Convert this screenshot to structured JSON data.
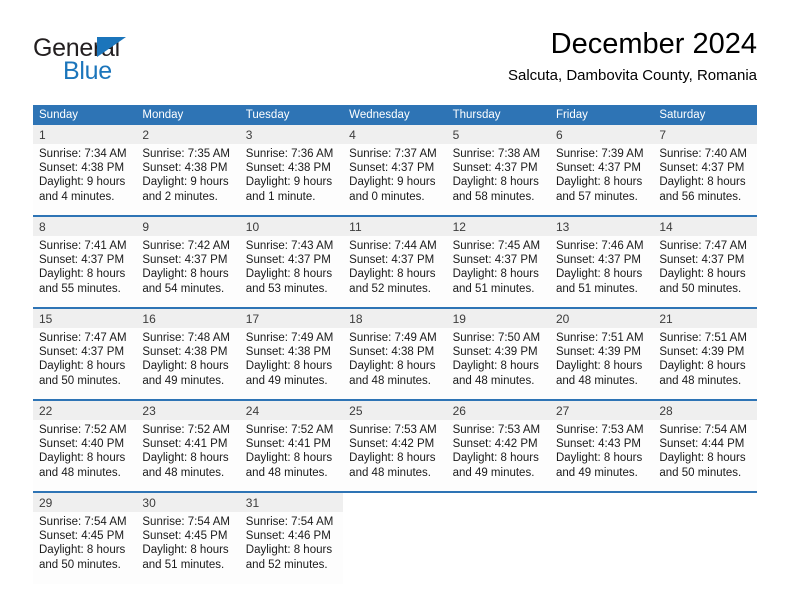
{
  "brand": {
    "name_part1": "General",
    "name_part2": "Blue",
    "triangle_icon": "triangle-icon",
    "primary_color": "#1b75bb"
  },
  "header": {
    "title": "December 2024",
    "subtitle": "Salcuta, Dambovita County, Romania"
  },
  "theme": {
    "header_bg": "#2e74b5",
    "daynum_bg": "#efefef",
    "cell_bg": "#fdfdfd"
  },
  "weekdays": [
    "Sunday",
    "Monday",
    "Tuesday",
    "Wednesday",
    "Thursday",
    "Friday",
    "Saturday"
  ],
  "weeks": [
    {
      "days": [
        {
          "num": "1",
          "sunrise": "Sunrise: 7:34 AM",
          "sunset": "Sunset: 4:38 PM",
          "daylight_1": "Daylight: 9 hours",
          "daylight_2": "and 4 minutes."
        },
        {
          "num": "2",
          "sunrise": "Sunrise: 7:35 AM",
          "sunset": "Sunset: 4:38 PM",
          "daylight_1": "Daylight: 9 hours",
          "daylight_2": "and 2 minutes."
        },
        {
          "num": "3",
          "sunrise": "Sunrise: 7:36 AM",
          "sunset": "Sunset: 4:38 PM",
          "daylight_1": "Daylight: 9 hours",
          "daylight_2": "and 1 minute."
        },
        {
          "num": "4",
          "sunrise": "Sunrise: 7:37 AM",
          "sunset": "Sunset: 4:37 PM",
          "daylight_1": "Daylight: 9 hours",
          "daylight_2": "and 0 minutes."
        },
        {
          "num": "5",
          "sunrise": "Sunrise: 7:38 AM",
          "sunset": "Sunset: 4:37 PM",
          "daylight_1": "Daylight: 8 hours",
          "daylight_2": "and 58 minutes."
        },
        {
          "num": "6",
          "sunrise": "Sunrise: 7:39 AM",
          "sunset": "Sunset: 4:37 PM",
          "daylight_1": "Daylight: 8 hours",
          "daylight_2": "and 57 minutes."
        },
        {
          "num": "7",
          "sunrise": "Sunrise: 7:40 AM",
          "sunset": "Sunset: 4:37 PM",
          "daylight_1": "Daylight: 8 hours",
          "daylight_2": "and 56 minutes."
        }
      ]
    },
    {
      "days": [
        {
          "num": "8",
          "sunrise": "Sunrise: 7:41 AM",
          "sunset": "Sunset: 4:37 PM",
          "daylight_1": "Daylight: 8 hours",
          "daylight_2": "and 55 minutes."
        },
        {
          "num": "9",
          "sunrise": "Sunrise: 7:42 AM",
          "sunset": "Sunset: 4:37 PM",
          "daylight_1": "Daylight: 8 hours",
          "daylight_2": "and 54 minutes."
        },
        {
          "num": "10",
          "sunrise": "Sunrise: 7:43 AM",
          "sunset": "Sunset: 4:37 PM",
          "daylight_1": "Daylight: 8 hours",
          "daylight_2": "and 53 minutes."
        },
        {
          "num": "11",
          "sunrise": "Sunrise: 7:44 AM",
          "sunset": "Sunset: 4:37 PM",
          "daylight_1": "Daylight: 8 hours",
          "daylight_2": "and 52 minutes."
        },
        {
          "num": "12",
          "sunrise": "Sunrise: 7:45 AM",
          "sunset": "Sunset: 4:37 PM",
          "daylight_1": "Daylight: 8 hours",
          "daylight_2": "and 51 minutes."
        },
        {
          "num": "13",
          "sunrise": "Sunrise: 7:46 AM",
          "sunset": "Sunset: 4:37 PM",
          "daylight_1": "Daylight: 8 hours",
          "daylight_2": "and 51 minutes."
        },
        {
          "num": "14",
          "sunrise": "Sunrise: 7:47 AM",
          "sunset": "Sunset: 4:37 PM",
          "daylight_1": "Daylight: 8 hours",
          "daylight_2": "and 50 minutes."
        }
      ]
    },
    {
      "days": [
        {
          "num": "15",
          "sunrise": "Sunrise: 7:47 AM",
          "sunset": "Sunset: 4:37 PM",
          "daylight_1": "Daylight: 8 hours",
          "daylight_2": "and 50 minutes."
        },
        {
          "num": "16",
          "sunrise": "Sunrise: 7:48 AM",
          "sunset": "Sunset: 4:38 PM",
          "daylight_1": "Daylight: 8 hours",
          "daylight_2": "and 49 minutes."
        },
        {
          "num": "17",
          "sunrise": "Sunrise: 7:49 AM",
          "sunset": "Sunset: 4:38 PM",
          "daylight_1": "Daylight: 8 hours",
          "daylight_2": "and 49 minutes."
        },
        {
          "num": "18",
          "sunrise": "Sunrise: 7:49 AM",
          "sunset": "Sunset: 4:38 PM",
          "daylight_1": "Daylight: 8 hours",
          "daylight_2": "and 48 minutes."
        },
        {
          "num": "19",
          "sunrise": "Sunrise: 7:50 AM",
          "sunset": "Sunset: 4:39 PM",
          "daylight_1": "Daylight: 8 hours",
          "daylight_2": "and 48 minutes."
        },
        {
          "num": "20",
          "sunrise": "Sunrise: 7:51 AM",
          "sunset": "Sunset: 4:39 PM",
          "daylight_1": "Daylight: 8 hours",
          "daylight_2": "and 48 minutes."
        },
        {
          "num": "21",
          "sunrise": "Sunrise: 7:51 AM",
          "sunset": "Sunset: 4:39 PM",
          "daylight_1": "Daylight: 8 hours",
          "daylight_2": "and 48 minutes."
        }
      ]
    },
    {
      "days": [
        {
          "num": "22",
          "sunrise": "Sunrise: 7:52 AM",
          "sunset": "Sunset: 4:40 PM",
          "daylight_1": "Daylight: 8 hours",
          "daylight_2": "and 48 minutes."
        },
        {
          "num": "23",
          "sunrise": "Sunrise: 7:52 AM",
          "sunset": "Sunset: 4:41 PM",
          "daylight_1": "Daylight: 8 hours",
          "daylight_2": "and 48 minutes."
        },
        {
          "num": "24",
          "sunrise": "Sunrise: 7:52 AM",
          "sunset": "Sunset: 4:41 PM",
          "daylight_1": "Daylight: 8 hours",
          "daylight_2": "and 48 minutes."
        },
        {
          "num": "25",
          "sunrise": "Sunrise: 7:53 AM",
          "sunset": "Sunset: 4:42 PM",
          "daylight_1": "Daylight: 8 hours",
          "daylight_2": "and 48 minutes."
        },
        {
          "num": "26",
          "sunrise": "Sunrise: 7:53 AM",
          "sunset": "Sunset: 4:42 PM",
          "daylight_1": "Daylight: 8 hours",
          "daylight_2": "and 49 minutes."
        },
        {
          "num": "27",
          "sunrise": "Sunrise: 7:53 AM",
          "sunset": "Sunset: 4:43 PM",
          "daylight_1": "Daylight: 8 hours",
          "daylight_2": "and 49 minutes."
        },
        {
          "num": "28",
          "sunrise": "Sunrise: 7:54 AM",
          "sunset": "Sunset: 4:44 PM",
          "daylight_1": "Daylight: 8 hours",
          "daylight_2": "and 50 minutes."
        }
      ]
    },
    {
      "days": [
        {
          "num": "29",
          "sunrise": "Sunrise: 7:54 AM",
          "sunset": "Sunset: 4:45 PM",
          "daylight_1": "Daylight: 8 hours",
          "daylight_2": "and 50 minutes."
        },
        {
          "num": "30",
          "sunrise": "Sunrise: 7:54 AM",
          "sunset": "Sunset: 4:45 PM",
          "daylight_1": "Daylight: 8 hours",
          "daylight_2": "and 51 minutes."
        },
        {
          "num": "31",
          "sunrise": "Sunrise: 7:54 AM",
          "sunset": "Sunset: 4:46 PM",
          "daylight_1": "Daylight: 8 hours",
          "daylight_2": "and 52 minutes."
        },
        {
          "num": "",
          "sunrise": "",
          "sunset": "",
          "daylight_1": "",
          "daylight_2": ""
        },
        {
          "num": "",
          "sunrise": "",
          "sunset": "",
          "daylight_1": "",
          "daylight_2": ""
        },
        {
          "num": "",
          "sunrise": "",
          "sunset": "",
          "daylight_1": "",
          "daylight_2": ""
        },
        {
          "num": "",
          "sunrise": "",
          "sunset": "",
          "daylight_1": "",
          "daylight_2": ""
        }
      ]
    }
  ]
}
